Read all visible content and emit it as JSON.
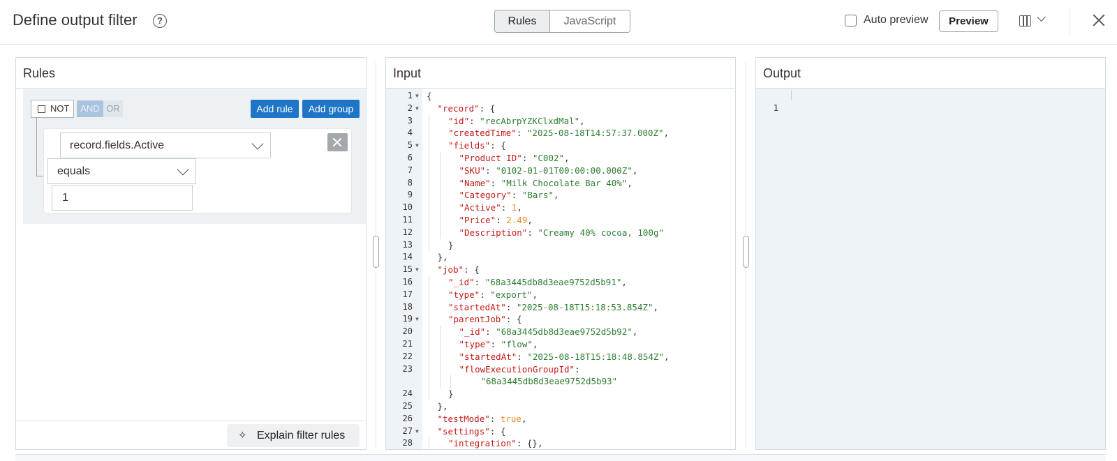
{
  "header": {
    "title": "Define output filter",
    "help_icon": "help-circle-icon",
    "toggle": {
      "rules": "Rules",
      "javascript": "JavaScript",
      "active": "Rules"
    },
    "auto_preview_label": "Auto preview",
    "auto_preview_checked": false,
    "preview_label": "Preview"
  },
  "rules_panel": {
    "title": "Rules",
    "not_label": "NOT",
    "and_label": "AND",
    "or_label": "OR",
    "add_rule_label": "Add rule",
    "add_group_label": "Add group",
    "rule": {
      "field": "record.fields.Active",
      "operator": "equals",
      "value": "1"
    },
    "explain_label": "Explain filter rules"
  },
  "input_panel": {
    "title": "Input",
    "lines": [
      {
        "n": "1",
        "fold": true,
        "indent": 0,
        "tokens": [
          [
            "p",
            "{"
          ]
        ]
      },
      {
        "n": "2",
        "fold": true,
        "indent": 1,
        "tokens": [
          [
            "k",
            "\"record\""
          ],
          [
            "p",
            ": {"
          ]
        ]
      },
      {
        "n": "3",
        "fold": false,
        "indent": 2,
        "tokens": [
          [
            "k",
            "\"id\""
          ],
          [
            "p",
            ": "
          ],
          [
            "s",
            "\"recAbrpYZKClxdMal\""
          ],
          [
            "p",
            ","
          ]
        ]
      },
      {
        "n": "4",
        "fold": false,
        "indent": 2,
        "tokens": [
          [
            "k",
            "\"createdTime\""
          ],
          [
            "p",
            ": "
          ],
          [
            "s",
            "\"2025-08-18T14:57:37.000Z\""
          ],
          [
            "p",
            ","
          ]
        ]
      },
      {
        "n": "5",
        "fold": true,
        "indent": 2,
        "tokens": [
          [
            "k",
            "\"fields\""
          ],
          [
            "p",
            ": {"
          ]
        ]
      },
      {
        "n": "6",
        "fold": false,
        "indent": 3,
        "tokens": [
          [
            "k",
            "\"Product ID\""
          ],
          [
            "p",
            ": "
          ],
          [
            "s",
            "\"C002\""
          ],
          [
            "p",
            ","
          ]
        ]
      },
      {
        "n": "7",
        "fold": false,
        "indent": 3,
        "tokens": [
          [
            "k",
            "\"SKU\""
          ],
          [
            "p",
            ": "
          ],
          [
            "s",
            "\"0102-01-01T00:00:00.000Z\""
          ],
          [
            "p",
            ","
          ]
        ]
      },
      {
        "n": "8",
        "fold": false,
        "indent": 3,
        "tokens": [
          [
            "k",
            "\"Name\""
          ],
          [
            "p",
            ": "
          ],
          [
            "s",
            "\"Milk Chocolate Bar 40%\""
          ],
          [
            "p",
            ","
          ]
        ]
      },
      {
        "n": "9",
        "fold": false,
        "indent": 3,
        "tokens": [
          [
            "k",
            "\"Category\""
          ],
          [
            "p",
            ": "
          ],
          [
            "s",
            "\"Bars\""
          ],
          [
            "p",
            ","
          ]
        ]
      },
      {
        "n": "10",
        "fold": false,
        "indent": 3,
        "tokens": [
          [
            "k",
            "\"Active\""
          ],
          [
            "p",
            ": "
          ],
          [
            "n",
            "1"
          ],
          [
            "p",
            ","
          ]
        ]
      },
      {
        "n": "11",
        "fold": false,
        "indent": 3,
        "tokens": [
          [
            "k",
            "\"Price\""
          ],
          [
            "p",
            ": "
          ],
          [
            "n",
            "2.49"
          ],
          [
            "p",
            ","
          ]
        ]
      },
      {
        "n": "12",
        "fold": false,
        "indent": 3,
        "tokens": [
          [
            "k",
            "\"Description\""
          ],
          [
            "p",
            ": "
          ],
          [
            "s",
            "\"Creamy 40% cocoa, 100g\""
          ]
        ]
      },
      {
        "n": "13",
        "fold": false,
        "indent": 2,
        "tokens": [
          [
            "p",
            "}"
          ]
        ]
      },
      {
        "n": "14",
        "fold": false,
        "indent": 1,
        "tokens": [
          [
            "p",
            "},"
          ]
        ]
      },
      {
        "n": "15",
        "fold": true,
        "indent": 1,
        "tokens": [
          [
            "k",
            "\"job\""
          ],
          [
            "p",
            ": {"
          ]
        ]
      },
      {
        "n": "16",
        "fold": false,
        "indent": 2,
        "tokens": [
          [
            "k",
            "\"_id\""
          ],
          [
            "p",
            ": "
          ],
          [
            "s",
            "\"68a3445db8d3eae9752d5b91\""
          ],
          [
            "p",
            ","
          ]
        ]
      },
      {
        "n": "17",
        "fold": false,
        "indent": 2,
        "tokens": [
          [
            "k",
            "\"type\""
          ],
          [
            "p",
            ": "
          ],
          [
            "s",
            "\"export\""
          ],
          [
            "p",
            ","
          ]
        ]
      },
      {
        "n": "18",
        "fold": false,
        "indent": 2,
        "tokens": [
          [
            "k",
            "\"startedAt\""
          ],
          [
            "p",
            ": "
          ],
          [
            "s",
            "\"2025-08-18T15:18:53.854Z\""
          ],
          [
            "p",
            ","
          ]
        ]
      },
      {
        "n": "19",
        "fold": true,
        "indent": 2,
        "tokens": [
          [
            "k",
            "\"parentJob\""
          ],
          [
            "p",
            ": {"
          ]
        ]
      },
      {
        "n": "20",
        "fold": false,
        "indent": 3,
        "tokens": [
          [
            "k",
            "\"_id\""
          ],
          [
            "p",
            ": "
          ],
          [
            "s",
            "\"68a3445db8d3eae9752d5b92\""
          ],
          [
            "p",
            ","
          ]
        ]
      },
      {
        "n": "21",
        "fold": false,
        "indent": 3,
        "tokens": [
          [
            "k",
            "\"type\""
          ],
          [
            "p",
            ": "
          ],
          [
            "s",
            "\"flow\""
          ],
          [
            "p",
            ","
          ]
        ]
      },
      {
        "n": "22",
        "fold": false,
        "indent": 3,
        "tokens": [
          [
            "k",
            "\"startedAt\""
          ],
          [
            "p",
            ": "
          ],
          [
            "s",
            "\"2025-08-18T15:18:48.854Z\""
          ],
          [
            "p",
            ","
          ]
        ]
      },
      {
        "n": "23",
        "fold": false,
        "indent": 3,
        "tokens": [
          [
            "k",
            "\"flowExecutionGroupId\""
          ],
          [
            "p",
            ":"
          ]
        ]
      },
      {
        "n": "",
        "fold": false,
        "indent": 5,
        "tokens": [
          [
            "s",
            "\"68a3445db8d3eae9752d5b93\""
          ]
        ]
      },
      {
        "n": "24",
        "fold": false,
        "indent": 2,
        "tokens": [
          [
            "p",
            "}"
          ]
        ]
      },
      {
        "n": "25",
        "fold": false,
        "indent": 1,
        "tokens": [
          [
            "p",
            "},"
          ]
        ]
      },
      {
        "n": "26",
        "fold": false,
        "indent": 1,
        "tokens": [
          [
            "k",
            "\"testMode\""
          ],
          [
            "p",
            ": "
          ],
          [
            "b",
            "true"
          ],
          [
            "p",
            ","
          ]
        ]
      },
      {
        "n": "27",
        "fold": true,
        "indent": 1,
        "tokens": [
          [
            "k",
            "\"settings\""
          ],
          [
            "p",
            ": {"
          ]
        ]
      },
      {
        "n": "28",
        "fold": false,
        "indent": 2,
        "tokens": [
          [
            "k",
            "\"integration\""
          ],
          [
            "p",
            ": {},"
          ]
        ]
      }
    ]
  },
  "output_panel": {
    "title": "Output",
    "lines": [
      {
        "n": "1",
        "text": ""
      }
    ]
  }
}
